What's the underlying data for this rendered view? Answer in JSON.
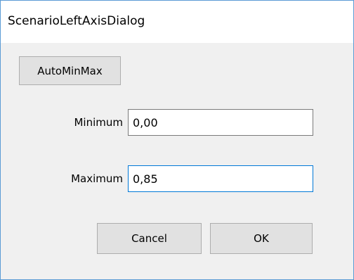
{
  "window": {
    "title": "ScenarioLeftAxisDialog"
  },
  "buttons": {
    "auto_min_max": "AutoMinMax",
    "cancel": "Cancel",
    "ok": "OK"
  },
  "fields": {
    "minimum": {
      "label": "Minimum",
      "value": "0,00"
    },
    "maximum": {
      "label": "Maximum",
      "value": "0,85"
    }
  },
  "colors": {
    "focus_border": "#0078d7",
    "window_border": "#5b9bd5",
    "dialog_background": "#f0f0f0"
  }
}
